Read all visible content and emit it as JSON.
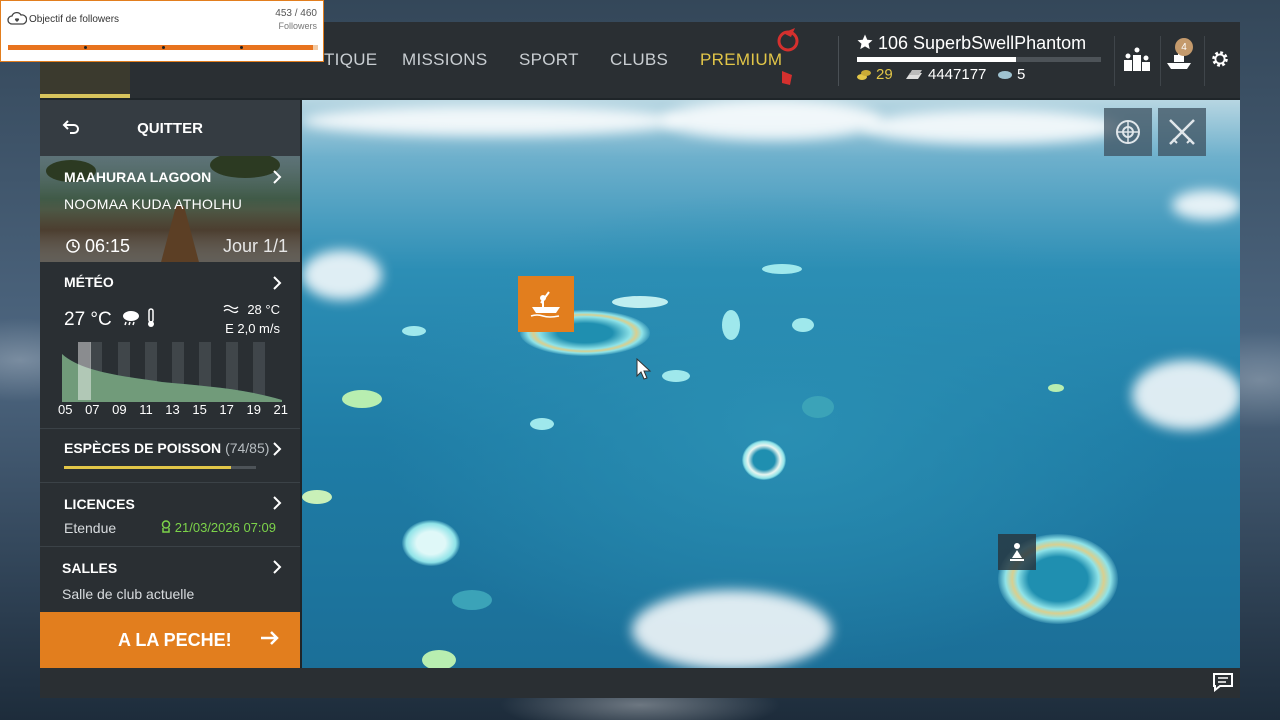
{
  "followers_widget": {
    "title": "Objectif de followers",
    "current": "453",
    "goal": "460",
    "count_text": "453 / 460",
    "unit": "Followers",
    "progress": 0.985
  },
  "topnav": {
    "items": [
      "TIQUE",
      "MISSIONS",
      "SPORT",
      "CLUBS",
      "PREMIUM"
    ],
    "player": {
      "level": "106",
      "name": "SuperbSwellPhantom",
      "display": "106 SuperbSwellPhantom",
      "xp_progress": 0.65
    },
    "currency": {
      "gold": "29",
      "silver": "4447177",
      "bait": "5"
    },
    "icons": [
      "leaderboard-icon",
      "boat-icon",
      "settings-icon"
    ],
    "notification_count": "4"
  },
  "left_panel": {
    "quit_label": "QUITTER",
    "location": {
      "name": "MAAHURAA LAGOON",
      "region": "NOOMAA KUDA ATHOLHU",
      "time": "06:15",
      "day": "Jour 1/1"
    },
    "weather": {
      "title": "MÉTÉO",
      "air_temp": "27 °C",
      "water_temp": "28 °C",
      "wind": "E 2,0 m/s",
      "hours": [
        "05",
        "07",
        "09",
        "11",
        "13",
        "15",
        "17",
        "19",
        "21"
      ]
    },
    "species": {
      "title": "ESPÈCES DE POISSON",
      "count": "(74/85)",
      "progress": 0.87
    },
    "licences": {
      "title": "LICENCES",
      "type": "Etendue",
      "expiry": "21/03/2026 07:09"
    },
    "salles": {
      "title": "SALLES",
      "subtitle": "Salle de club actuelle"
    },
    "go_label": "A LA PECHE!"
  },
  "colors": {
    "accent": "#e27e1e",
    "gold": "#e2c648",
    "green": "#7cd34a",
    "panel": "#2a2f33"
  }
}
